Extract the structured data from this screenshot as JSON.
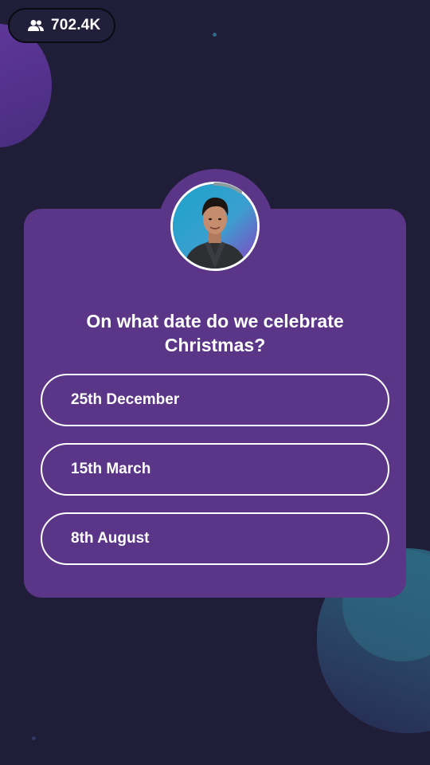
{
  "viewers": {
    "icon": "users-icon",
    "count": "702.4K"
  },
  "host": {
    "avatar_icon": "host-avatar-photo"
  },
  "question": {
    "text": "On what date do we celebrate Christmas?"
  },
  "options": [
    {
      "label": "25th December"
    },
    {
      "label": "15th March"
    },
    {
      "label": "8th August"
    }
  ],
  "colors": {
    "background": "#1f1d38",
    "card": "#5b3587",
    "option_border": "#ffffff",
    "text": "#ffffff"
  }
}
